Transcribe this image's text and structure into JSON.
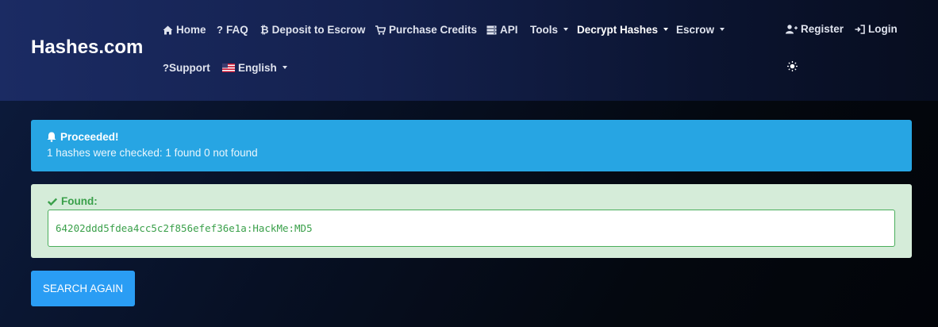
{
  "brand": "Hashes.com",
  "nav": {
    "home": "Home",
    "faq": "FAQ",
    "deposit": "Deposit to Escrow",
    "purchase": "Purchase Credits",
    "api": "API",
    "tools": "Tools",
    "decrypt": "Decrypt Hashes",
    "escrow": "Escrow",
    "support": "Support",
    "language": "English",
    "register": "Register",
    "login": "Login"
  },
  "icons": {
    "home": "home-icon",
    "faq": "question-icon",
    "deposit": "bitcoin-icon",
    "purchase": "cart-icon",
    "api": "server-icon",
    "support": "question-icon",
    "language": "us-flag-icon",
    "register": "user-plus-icon",
    "login": "sign-in-icon",
    "theme": "sun-icon",
    "bell": "bell-icon",
    "check": "check-icon"
  },
  "alert_info": {
    "title": "Proceeded!",
    "message": "1 hashes were checked: 1 found 0 not found"
  },
  "alert_success": {
    "title": "Found:",
    "result": "64202ddd5fdea4cc5c2f856efef36e1a:HackMe:MD5"
  },
  "search_again": "SEARCH AGAIN",
  "colors": {
    "info": "#27a5e3",
    "success_bg": "#d5ecd9",
    "success_text": "#3aa04a",
    "button": "#2a9df4"
  }
}
